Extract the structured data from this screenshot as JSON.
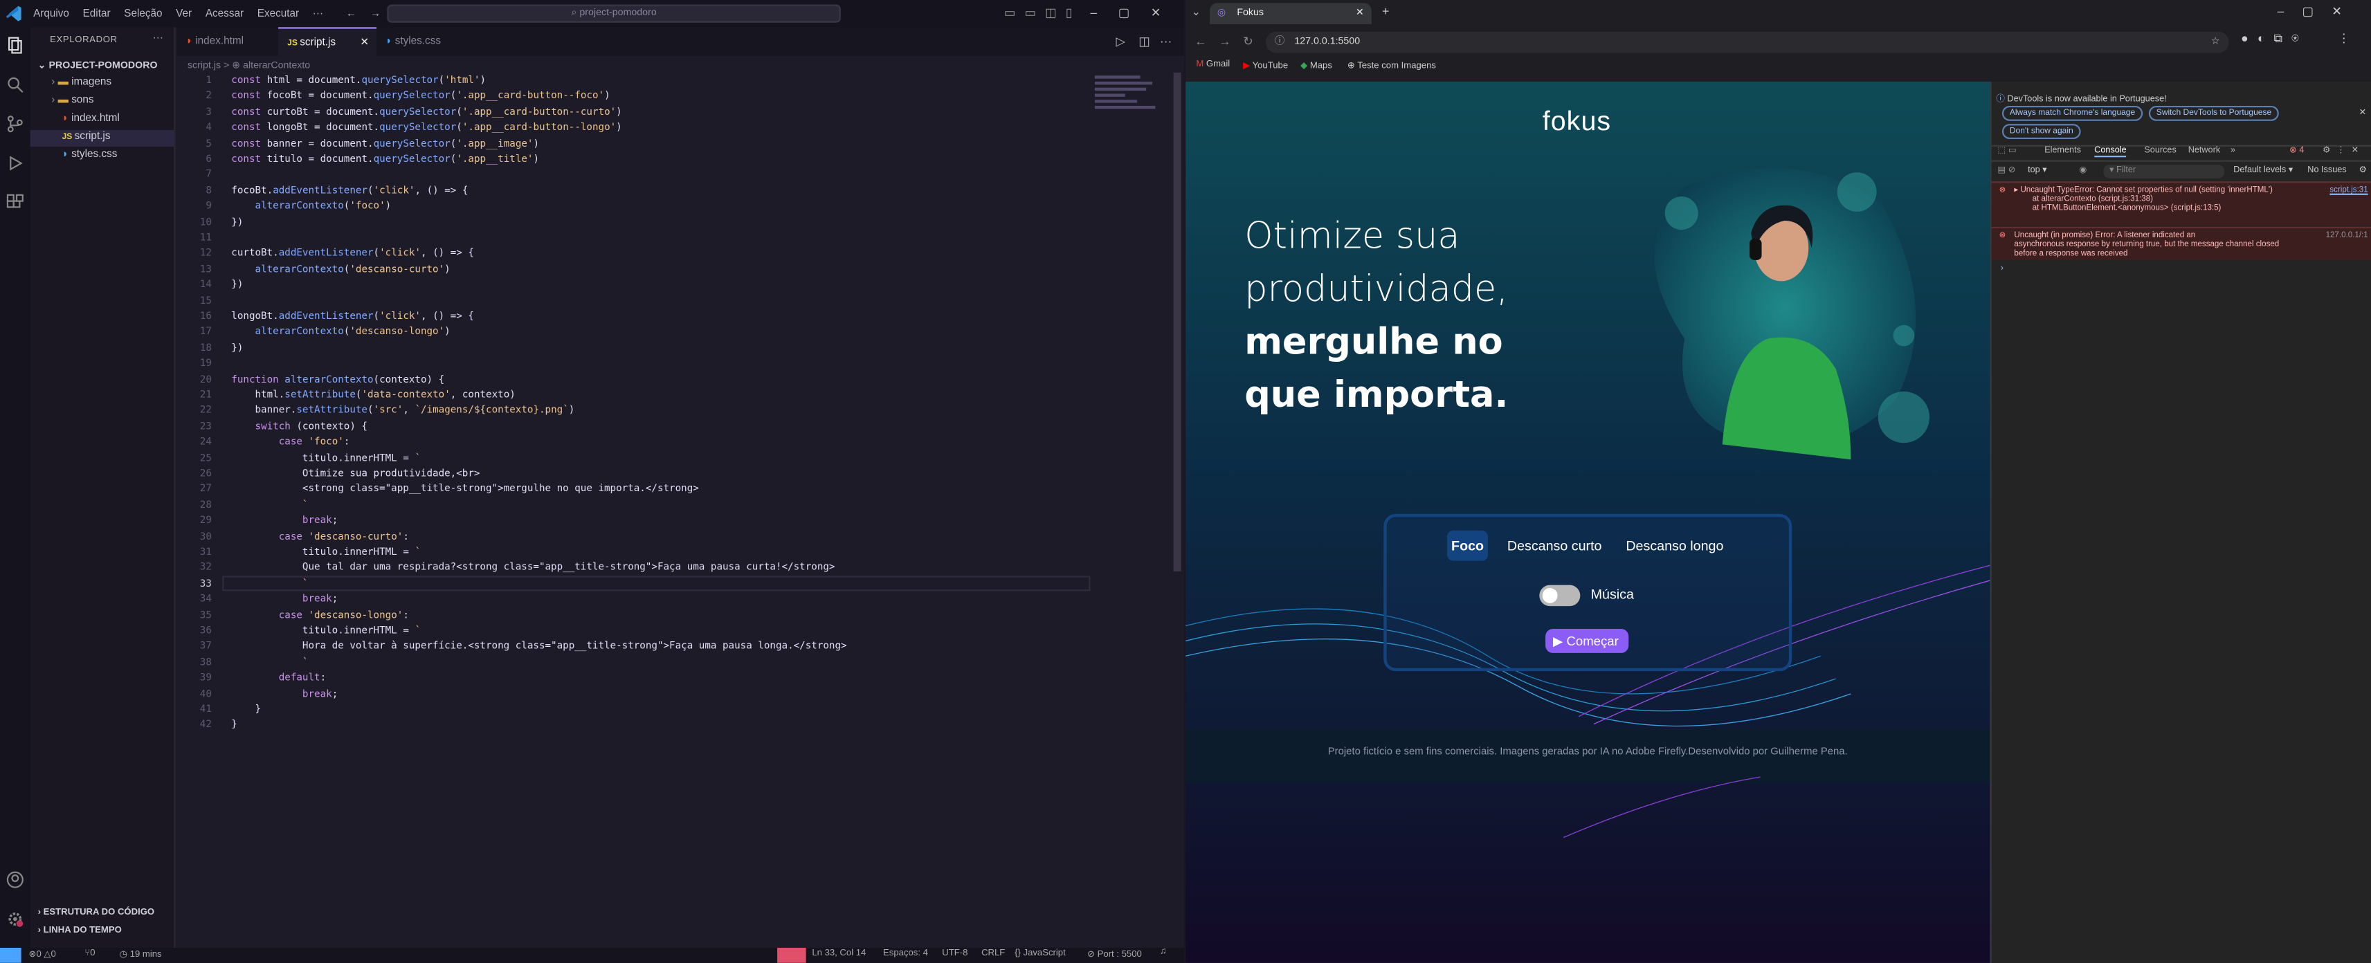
{
  "vscode": {
    "menu": [
      "Arquivo",
      "Editar",
      "Seleção",
      "Ver",
      "Acessar",
      "Executar",
      "···"
    ],
    "search_placeholder": "project-pomodoro",
    "explorer_title": "EXPLORADOR",
    "project": "PROJECT-POMODORO",
    "tree": [
      "imagens",
      "sons",
      "index.html",
      "script.js",
      "styles.css"
    ],
    "tabs": [
      "index.html",
      "script.js",
      "styles.css"
    ],
    "breadcrumb": "script.js > ⊕ alterarContexto",
    "outline": "ESTRUTURA DO CÓDIGO",
    "timeline": "LINHA DO TEMPO",
    "code": [
      "const html = document.querySelector('html')",
      "const focoBt = document.querySelector('.app__card-button--foco')",
      "const curtoBt = document.querySelector('.app__card-button--curto')",
      "const longoBt = document.querySelector('.app__card-button--longo')",
      "const banner = document.querySelector('.app__image')",
      "const titulo = document.querySelector('.app__title')",
      "",
      "focoBt.addEventListener('click', () => {",
      "    alterarContexto('foco')",
      "})",
      "",
      "curtoBt.addEventListener('click', () => {",
      "    alterarContexto('descanso-curto')",
      "})",
      "",
      "longoBt.addEventListener('click', () => {",
      "    alterarContexto('descanso-longo')",
      "})",
      "",
      "function alterarContexto(contexto) {",
      "    html.setAttribute('data-contexto', contexto)",
      "    banner.setAttribute('src', `/imagens/${contexto}.png`)",
      "    switch (contexto) {",
      "        case 'foco':",
      "            titulo.innerHTML = `",
      "            Otimize sua produtividade,<br>",
      "            <strong class=\"app__title-strong\">mergulhe no que importa.</strong>",
      "            `",
      "            break;",
      "        case 'descanso-curto':",
      "            titulo.innerHTML = `",
      "            Que tal dar uma respirada?<strong class=\"app__title-strong\">Faça uma pausa curta!</strong>",
      "            `",
      "            break;",
      "        case 'descanso-longo':",
      "            titulo.innerHTML = `",
      "            Hora de voltar à superfície.<strong class=\"app__title-strong\">Faça uma pausa longa.</strong>",
      "            `",
      "        default:",
      "            break;",
      "    }",
      "}"
    ],
    "status": {
      "errors": "⊗0 △0",
      "ports": "⑂0",
      "time": "◷ 19 mins",
      "position": "Ln 33, Col 14",
      "spaces": "Espaços: 4",
      "encoding": "UTF-8",
      "eol": "CRLF",
      "language": "{} JavaScript",
      "port": "⊘ Port : 5500"
    }
  },
  "browser": {
    "tab_title": "Fokus",
    "url": "127.0.0.1:5500",
    "bookmarks": [
      "Gmail",
      "YouTube",
      "Maps",
      "Teste com Imagens"
    ],
    "page": {
      "logo": "fokus",
      "title_line1": "Otimize sua",
      "title_line2": "produtividade,",
      "title_strong1": "mergulhe no",
      "title_strong2": "que importa.",
      "buttons": [
        "Foco",
        "Descanso curto",
        "Descanso longo"
      ],
      "music_label": "Música",
      "music_on": false,
      "start_label": "Começar",
      "footer": "Projeto fictício e sem fins comerciais. Imagens geradas por IA no Adobe Firefly.Desenvolvido por Guilherme Pena."
    },
    "devtools": {
      "notice": "DevTools is now available in Portuguese!",
      "chips": [
        "Always match Chrome's language",
        "Switch DevTools to Portuguese",
        "Don't show again"
      ],
      "tabs": [
        "Elements",
        "Console",
        "Sources",
        "Network"
      ],
      "errors_count": "4",
      "context": "top",
      "filter_placeholder": "Filter",
      "levels": "Default levels",
      "issues": "No Issues",
      "messages": [
        {
          "text": "▸ Uncaught TypeError: Cannot set properties of null (setting 'innerHTML')",
          "l2": "at alterarContexto (script.js:31:38)",
          "l3": "at HTMLButtonElement.<anonymous> (script.js:13:5)",
          "src": "script.js:31"
        },
        {
          "text": "Uncaught (in promise) Error: A listener indicated an",
          "l2": "asynchronous response by returning true, but the message channel closed",
          "l3": "before a response was received",
          "src": "127.0.0.1/:1"
        }
      ]
    }
  },
  "colors": {
    "accent": "#8b5cf6",
    "active_button": "#144480",
    "card_border": "#144480"
  }
}
